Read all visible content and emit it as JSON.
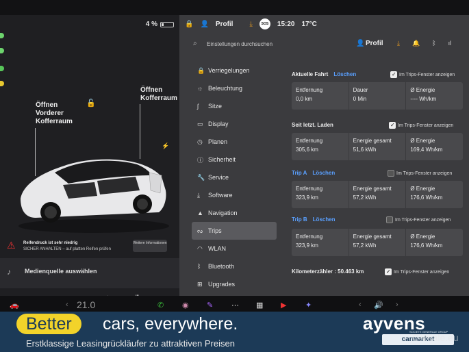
{
  "left": {
    "battery_pct": "4 %",
    "labels": {
      "front_trunk": "Öffnen\nVorderer\nKofferraum",
      "rear_trunk": "Öffnen\nKofferraum"
    },
    "alert_title": "Reifendruck ist sehr niedrig",
    "alert_text": "SICHER ANHALTEN – auf platten Reifen prüfen",
    "alert_button": "Weitere Informationen",
    "media_source": "Medienquelle auswählen"
  },
  "topbar": {
    "profile": "Profil",
    "time": "15:20",
    "temp": "17°C",
    "sos": "SOS"
  },
  "settings": {
    "search_placeholder": "Einstellungen durchsuchen",
    "profile": "Profil",
    "nav": [
      {
        "label": "Verriegelungen",
        "icon": "lock-icon"
      },
      {
        "label": "Beleuchtung",
        "icon": "light-icon"
      },
      {
        "label": "Sitze",
        "icon": "seat-icon"
      },
      {
        "label": "Display",
        "icon": "display-icon"
      },
      {
        "label": "Planen",
        "icon": "schedule-icon"
      },
      {
        "label": "Sicherheit",
        "icon": "info-icon"
      },
      {
        "label": "Service",
        "icon": "wrench-icon"
      },
      {
        "label": "Software",
        "icon": "download-icon"
      },
      {
        "label": "Navigation",
        "icon": "navigation-icon"
      },
      {
        "label": "Trips",
        "icon": "trips-icon"
      },
      {
        "label": "WLAN",
        "icon": "wifi-icon"
      },
      {
        "label": "Bluetooth",
        "icon": "bluetooth-icon"
      },
      {
        "label": "Upgrades",
        "icon": "upgrades-icon"
      }
    ],
    "active_nav": "Trips"
  },
  "trips": {
    "current": {
      "title": "Aktuelle Fahrt",
      "action": "Löschen",
      "checkbox": "Im Trips-Fenster anzeigen",
      "checked": true,
      "cells": [
        {
          "label": "Entfernung",
          "value": "0,0 km"
        },
        {
          "label": "Dauer",
          "value": "0 Min"
        },
        {
          "label": "Ø Energie",
          "value": "---- Wh/km"
        }
      ]
    },
    "since_charge": {
      "title": "Seit letzt. Laden",
      "checkbox": "Im Trips-Fenster anzeigen",
      "checked": true,
      "cells": [
        {
          "label": "Entfernung",
          "value": "305,6 km"
        },
        {
          "label": "Energie gesamt",
          "value": "51,6 kWh"
        },
        {
          "label": "Ø Energie",
          "value": "169,4 Wh/km"
        }
      ]
    },
    "trip_a": {
      "title": "Trip A",
      "action": "Löschen",
      "checkbox": "Im Trips-Fenster anzeigen",
      "checked": false,
      "cells": [
        {
          "label": "Entfernung",
          "value": "323,9 km"
        },
        {
          "label": "Energie gesamt",
          "value": "57,2 kWh"
        },
        {
          "label": "Ø Energie",
          "value": "176,6 Wh/km"
        }
      ]
    },
    "trip_b": {
      "title": "Trip B",
      "action": "Löschen",
      "checkbox": "Im Trips-Fenster anzeigen",
      "checked": false,
      "cells": [
        {
          "label": "Entfernung",
          "value": "323,9 km"
        },
        {
          "label": "Energie gesamt",
          "value": "57,2 kWh"
        },
        {
          "label": "Ø Energie",
          "value": "176,6 Wh/km"
        }
      ]
    },
    "odometer": "Kilometerzähler : 50.463 km",
    "odometer_checkbox": "Im Trips-Fenster anzeigen",
    "odometer_checked": true
  },
  "taskbar": {
    "temp": "21.0"
  },
  "banner": {
    "better": "Better",
    "slogan": "cars, everywhere.",
    "tagline": "Erstklassige Leasingrückläufer zu attraktiven Preisen",
    "brand": "ayvens",
    "brand_sub": "SOCIETE GENERALE GROUP",
    "carmarket": "carmarket",
    "watermark": "Carsale.eu"
  },
  "colors": {
    "accent_link": "#5aa0ff",
    "banner_bg": "#1c3a57",
    "banner_pill": "#f2d32a"
  }
}
